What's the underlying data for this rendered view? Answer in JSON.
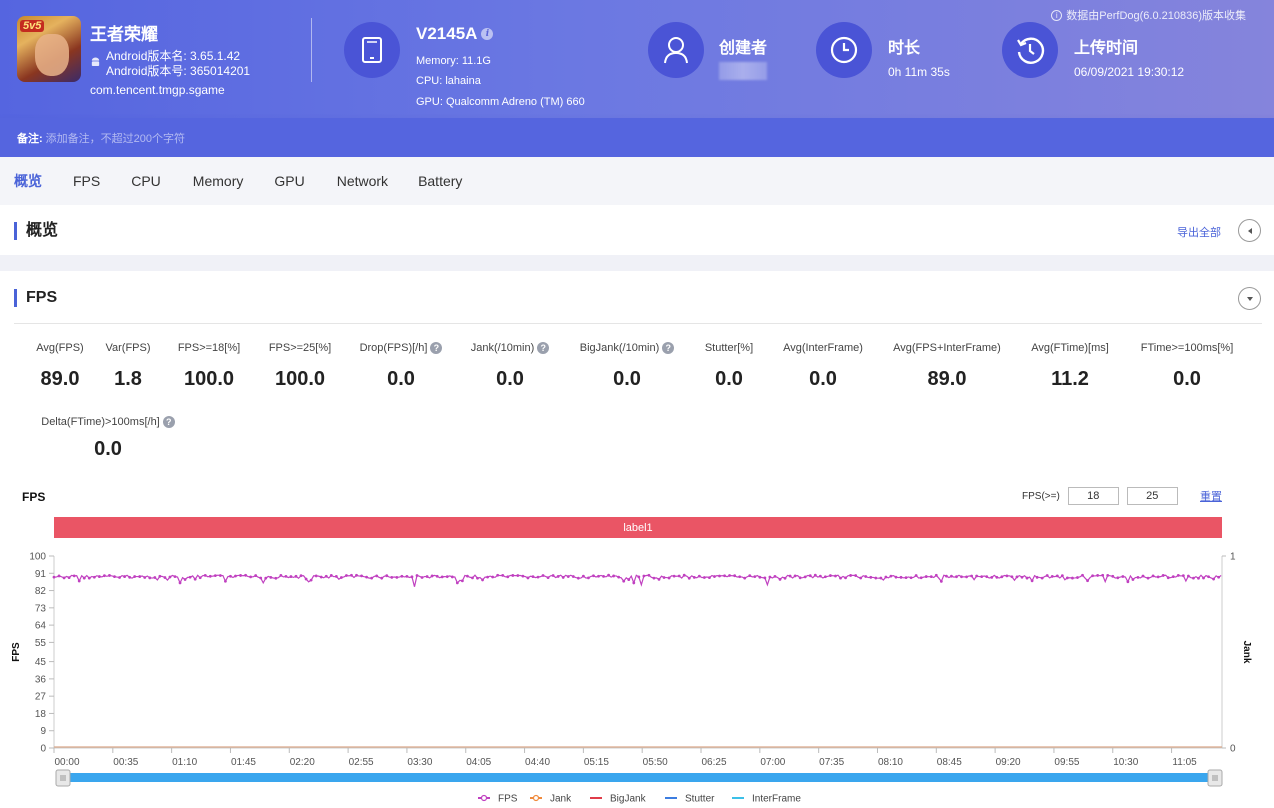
{
  "header": {
    "app": {
      "name": "王者荣耀",
      "icon_badge": "5v5",
      "version_name_line": "Android版本名: 3.65.1.42",
      "version_code_line": "Android版本号: 365014201",
      "package": "com.tencent.tmgp.sgame"
    },
    "device": {
      "model": "V2145A",
      "memory": "Memory: 11.1G",
      "cpu": "CPU: lahaina",
      "gpu": "GPU: Qualcomm Adreno (TM) 660"
    },
    "creator": {
      "label": "创建者",
      "value": ""
    },
    "duration": {
      "label": "时长",
      "value": "0h 11m 35s"
    },
    "upload": {
      "label": "上传时间",
      "value": "06/09/2021 19:30:12"
    },
    "collector_note": "数据由PerfDog(6.0.210836)版本收集",
    "note_label": "备注:",
    "note_placeholder": "添加备注，不超过200个字符"
  },
  "tabs": [
    {
      "label": "概览",
      "active": true
    },
    {
      "label": "FPS",
      "active": false
    },
    {
      "label": "CPU",
      "active": false
    },
    {
      "label": "Memory",
      "active": false
    },
    {
      "label": "GPU",
      "active": false
    },
    {
      "label": "Network",
      "active": false
    },
    {
      "label": "Battery",
      "active": false
    }
  ],
  "overview": {
    "title": "概览",
    "export_label": "导出全部"
  },
  "fps_section": {
    "title": "FPS",
    "stats": [
      {
        "label": "Avg(FPS)",
        "value": "89.0",
        "help": false
      },
      {
        "label": "Var(FPS)",
        "value": "1.8",
        "help": false
      },
      {
        "label": "FPS>=18[%]",
        "value": "100.0",
        "help": false
      },
      {
        "label": "FPS>=25[%]",
        "value": "100.0",
        "help": false
      },
      {
        "label": "Drop(FPS)[/h]",
        "value": "0.0",
        "help": true
      },
      {
        "label": "Jank(/10min)",
        "value": "0.0",
        "help": true
      },
      {
        "label": "BigJank(/10min)",
        "value": "0.0",
        "help": true
      },
      {
        "label": "Stutter[%]",
        "value": "0.0",
        "help": false
      },
      {
        "label": "Avg(InterFrame)",
        "value": "0.0",
        "help": false
      },
      {
        "label": "Avg(FPS+InterFrame)",
        "value": "89.0",
        "help": false
      },
      {
        "label": "Avg(FTime)[ms]",
        "value": "11.2",
        "help": false
      },
      {
        "label": "FTime>=100ms[%]",
        "value": "0.0",
        "help": false
      },
      {
        "label": "Delta(FTime)>100ms[/h]",
        "value": "0.0",
        "help": true
      }
    ],
    "help_glyph": "?",
    "chart_title": "FPS",
    "threshold_label": "FPS(>=)",
    "threshold_low": "18",
    "threshold_high": "25",
    "reset_label": "重置",
    "label_band": "label1"
  },
  "chart_data": {
    "type": "line",
    "title": "FPS",
    "ylabel": "FPS",
    "y2label": "Jank",
    "ylim": [
      0,
      100
    ],
    "y2lim": [
      0,
      1
    ],
    "yticks": [
      "0",
      "9",
      "18",
      "27",
      "36",
      "45",
      "55",
      "64",
      "73",
      "82",
      "91",
      "100"
    ],
    "y2ticks": [
      "0",
      "1"
    ],
    "xticks": [
      "00:00",
      "00:35",
      "01:10",
      "01:45",
      "02:20",
      "02:55",
      "03:30",
      "04:05",
      "04:40",
      "05:15",
      "05:50",
      "06:25",
      "07:00",
      "07:35",
      "08:10",
      "08:45",
      "09:20",
      "09:55",
      "10:30",
      "11:05"
    ],
    "duration_seconds": 695,
    "grid": false,
    "legend_position": "bottom",
    "legend": [
      {
        "name": "FPS",
        "color": "#c040c0",
        "marker": "circle"
      },
      {
        "name": "Jank",
        "color": "#f08a3c",
        "marker": "circle"
      },
      {
        "name": "BigJank",
        "color": "#e03c4a",
        "marker": "line"
      },
      {
        "name": "Stutter",
        "color": "#3c7de0",
        "marker": "line"
      },
      {
        "name": "InterFrame",
        "color": "#3cc0e8",
        "marker": "line"
      }
    ],
    "series": [
      {
        "name": "FPS",
        "baseline": 90,
        "dips": [
          {
            "t": 0,
            "v": 89
          },
          {
            "t": 15,
            "v": 87
          },
          {
            "t": 40,
            "v": 86
          },
          {
            "t": 55,
            "v": 87
          },
          {
            "t": 75,
            "v": 86
          },
          {
            "t": 100,
            "v": 87
          },
          {
            "t": 125,
            "v": 86
          },
          {
            "t": 150,
            "v": 88
          },
          {
            "t": 215,
            "v": 84
          },
          {
            "t": 220,
            "v": 83
          },
          {
            "t": 226,
            "v": 84
          },
          {
            "t": 232,
            "v": 83
          },
          {
            "t": 240,
            "v": 86
          },
          {
            "t": 250,
            "v": 83
          },
          {
            "t": 345,
            "v": 86
          },
          {
            "t": 350,
            "v": 85
          },
          {
            "t": 355,
            "v": 86
          },
          {
            "t": 415,
            "v": 86
          },
          {
            "t": 425,
            "v": 85
          },
          {
            "t": 430,
            "v": 82
          },
          {
            "t": 436,
            "v": 86
          },
          {
            "t": 520,
            "v": 88
          },
          {
            "t": 625,
            "v": 84
          },
          {
            "t": 690,
            "v": 88
          }
        ]
      },
      {
        "name": "Jank",
        "values_constant": 0
      },
      {
        "name": "BigJank",
        "values_constant": 0
      },
      {
        "name": "Stutter",
        "values_constant": 0
      },
      {
        "name": "InterFrame",
        "values_constant": 0
      }
    ]
  }
}
